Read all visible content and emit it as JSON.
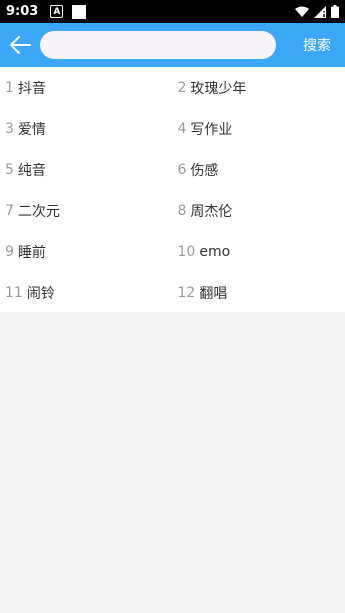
{
  "status_bar": {
    "time": "9:03",
    "notif_label": "A"
  },
  "search": {
    "placeholder": "",
    "value": "",
    "button_label": "搜索"
  },
  "hot_searches": [
    {
      "num": "1",
      "text": "抖音"
    },
    {
      "num": "2",
      "text": "玫瑰少年"
    },
    {
      "num": "3",
      "text": "爱情"
    },
    {
      "num": "4",
      "text": "写作业"
    },
    {
      "num": "5",
      "text": "纯音"
    },
    {
      "num": "6",
      "text": "伤感"
    },
    {
      "num": "7",
      "text": "二次元"
    },
    {
      "num": "8",
      "text": "周杰伦"
    },
    {
      "num": "9",
      "text": "睡前"
    },
    {
      "num": "10",
      "text": "emo"
    },
    {
      "num": "11",
      "text": "闹铃"
    },
    {
      "num": "12",
      "text": "翻唱"
    }
  ],
  "colors": {
    "accent": "#3aa8f7"
  }
}
